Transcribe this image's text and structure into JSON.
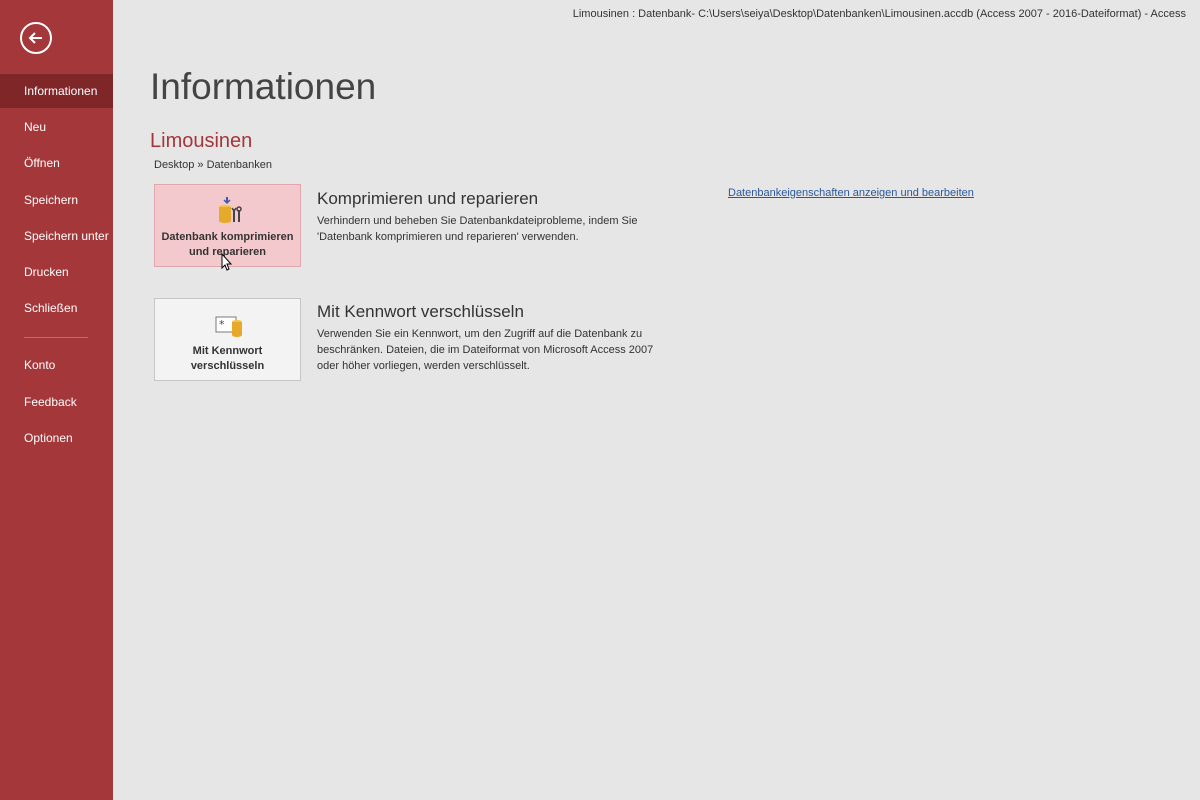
{
  "window": {
    "title": "Limousinen : Datenbank- C:\\Users\\seiya\\Desktop\\Datenbanken\\Limousinen.accdb (Access 2007 - 2016-Dateiformat)   -   Access"
  },
  "sidebar": {
    "back_icon": "arrow-left-circle-icon",
    "bg_color": "#a4373a",
    "active_color": "#7f2629",
    "items": [
      {
        "label": "Informationen",
        "active": true
      },
      {
        "label": "Neu"
      },
      {
        "label": "Öffnen"
      },
      {
        "label": "Speichern"
      },
      {
        "label": "Speichern unter"
      },
      {
        "label": "Drucken"
      },
      {
        "label": "Schließen"
      },
      {
        "label": "Konto"
      },
      {
        "label": "Feedback"
      },
      {
        "label": "Optionen"
      }
    ]
  },
  "main": {
    "title": "Informationen",
    "database_name": "Limousinen",
    "breadcrumb": "Desktop » Datenbanken",
    "properties_link": "Datenbankeigenschaften anzeigen und bearbeiten",
    "sections": [
      {
        "tile_label": "Datenbank komprimieren und reparieren",
        "icon": "compact-repair-database-icon",
        "heading": "Komprimieren und reparieren",
        "description": "Verhindern und beheben Sie Datenbankdateiprobleme, indem Sie 'Datenbank komprimieren und reparieren' verwenden."
      },
      {
        "tile_label": "Mit Kennwort verschlüsseln",
        "icon": "encrypt-password-icon",
        "heading": "Mit Kennwort verschlüsseln",
        "description": "Verwenden Sie ein Kennwort, um den Zugriff auf die Datenbank zu beschränken. Dateien, die im Dateiformat von Microsoft Access 2007 oder höher vorliegen, werden verschlüsselt."
      }
    ]
  }
}
